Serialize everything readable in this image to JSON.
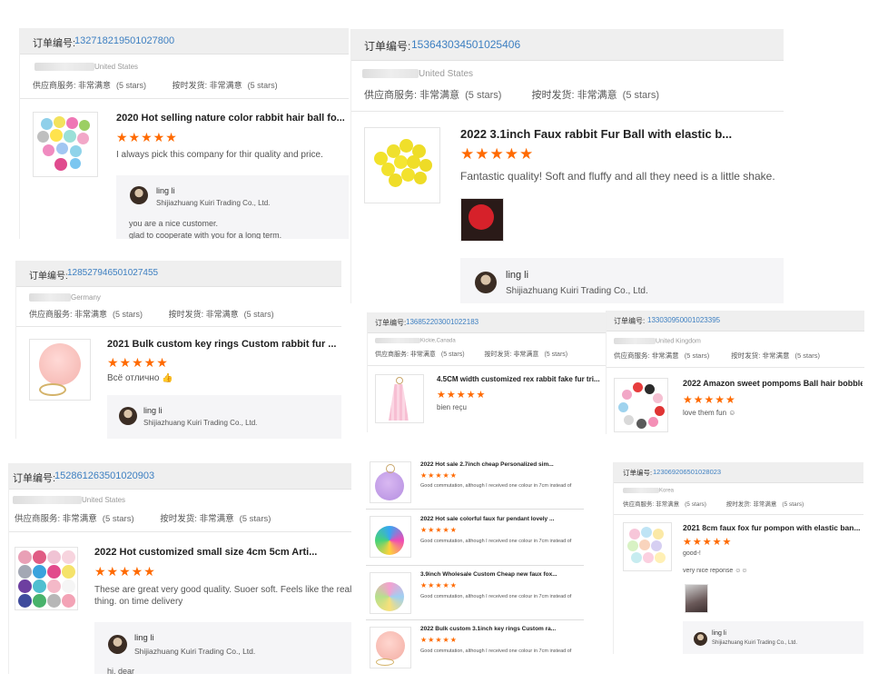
{
  "order_label": "订单编号:",
  "supplier_label": "供应商服务:",
  "shipping_label": "按时发货:",
  "very_satisfied": "非常满意",
  "five_stars": "(5 stars)",
  "stars_glyph": "★★★★★",
  "replier": {
    "name": "ling li",
    "company": "Shijiazhuang Kuiri Trading Co., Ltd."
  },
  "cards": [
    {
      "id": "c1",
      "order_no": "132718219501027800",
      "country": "United States",
      "title": "2020 Hot selling nature color rabbit hair ball fo...",
      "review": "I always pick this company for thir quality and price.",
      "reply_lines": [
        "you are a nice customer.",
        "glad to cooperate with you for a long term."
      ]
    },
    {
      "id": "c2",
      "order_no": "153643034501025406",
      "country": "United States",
      "title": "2022 3.1inch Faux rabbit Fur Ball with elastic b...",
      "review": "Fantastic quality! Soft and fluffy and all they need is a little shake."
    },
    {
      "id": "c3",
      "order_no": "128527946501027455",
      "country": "Germany",
      "title": "2021 Bulk custom key rings Custom rabbit fur ...",
      "review": "Всё отлично 👍"
    },
    {
      "id": "c4",
      "order_no": "136852203001022183",
      "country": "Kickie,Canada",
      "title": "4.5CM width customized rex rabbit fake fur tri...",
      "review": "bien reçu"
    },
    {
      "id": "c5",
      "order_no": "133030950001023395",
      "country": "United Kingdom",
      "title": "2022 Amazon sweet pompoms Ball hair bobble",
      "review": "love them fun ☺"
    },
    {
      "id": "c6",
      "order_no": "152861263501020903",
      "country": "United States",
      "title": "2022 Hot customized small size 4cm 5cm Arti...",
      "review_lines": [
        "These are great very good quality.  Suoer soft.  Feels like the real",
        "thing. on time delivery"
      ],
      "reply_lines": [
        "hi, dear"
      ]
    },
    {
      "id": "c7",
      "items": [
        {
          "title": "2022 Hot sale 2.7inch cheap Personalized sim...",
          "review": "Good commutation, although I received one colour in 7cm instead of"
        },
        {
          "title": "2022 Hot sale colorful faux fur pendant lovely ...",
          "review": "Good commutation, although I received one colour in 7cm instead of"
        },
        {
          "title": "3.9inch Wholesale Custom Cheap new faux fox...",
          "review": "Good commutation, although I received one colour in 7cm instead of"
        },
        {
          "title": "2022 Bulk custom 3.1inch key rings Custom ra...",
          "review": "Good commutation, although I received one colour in 7cm instead of"
        }
      ]
    },
    {
      "id": "c8",
      "order_no": "123069206501028023",
      "country": "Korea",
      "title": "2021 8cm faux fox fur pompon with elastic ban...",
      "review": "good-!",
      "review2": "very nice reponse ☺☺"
    }
  ]
}
